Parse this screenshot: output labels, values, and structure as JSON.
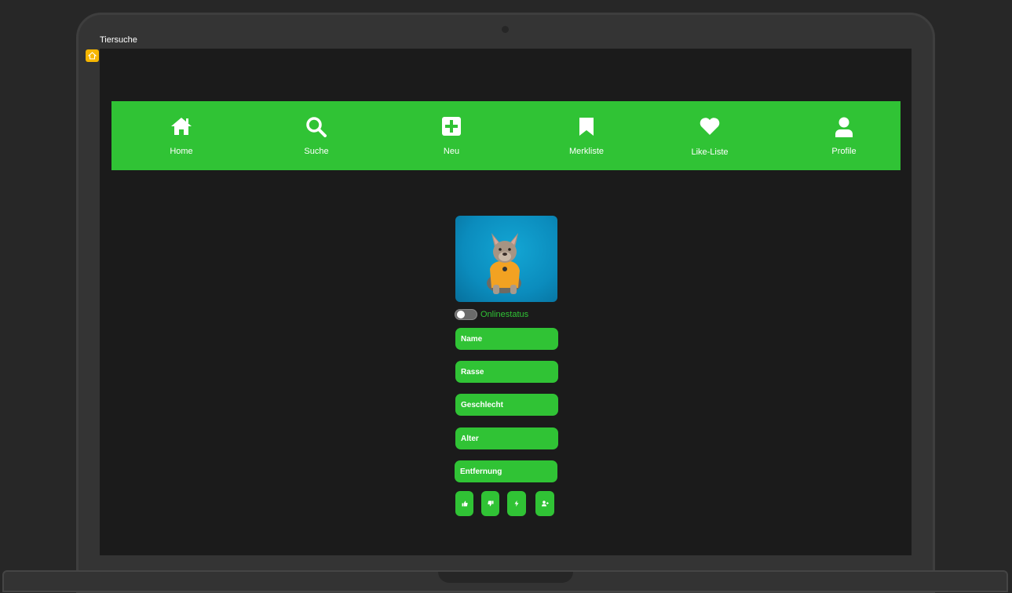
{
  "window": {
    "title": "Tiersuche"
  },
  "nav": {
    "items": [
      {
        "label": "Home",
        "icon": "home-icon"
      },
      {
        "label": "Suche",
        "icon": "search-icon"
      },
      {
        "label": "Neu",
        "icon": "plus-square-icon"
      },
      {
        "label": "Merkliste",
        "icon": "bookmark-icon"
      },
      {
        "label": "Like-Liste",
        "icon": "heart-icon"
      },
      {
        "label": "Profile",
        "icon": "user-icon"
      }
    ]
  },
  "profile": {
    "photo": "french-bulldog-photo",
    "online_label": "Onlinestatus",
    "online": false,
    "fields": {
      "name": "Name",
      "rasse": "Rasse",
      "geschlecht": "Geschlecht",
      "alter": "Alter",
      "entfernung": "Entfernung"
    },
    "actions": [
      "thumbs-up-icon",
      "thumbs-down-icon",
      "bolt-icon",
      "user-plus-icon"
    ]
  },
  "colors": {
    "accent": "#30c335",
    "screen_bg": "#1b1b1b",
    "frame": "#343434",
    "badge": "#f6b600"
  }
}
